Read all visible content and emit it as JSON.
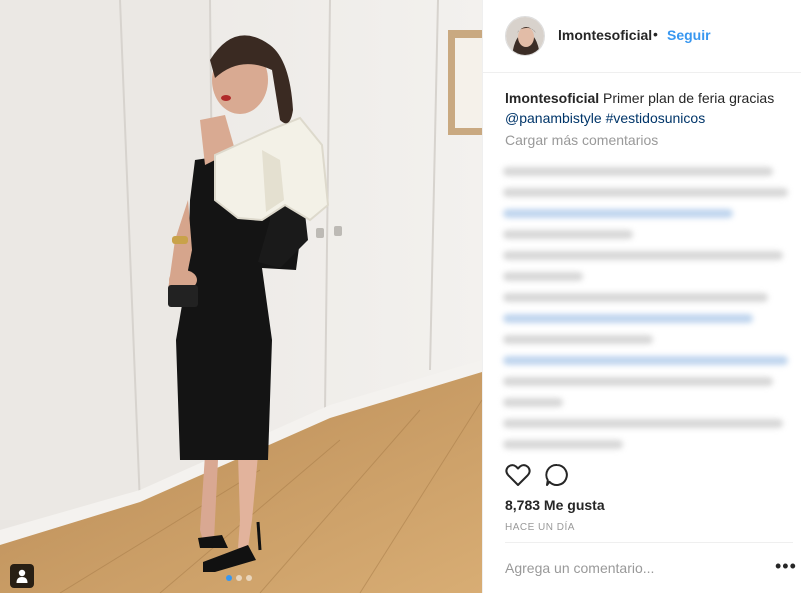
{
  "post": {
    "username": "lmontesoficial",
    "separator": "•",
    "follow_label": "Seguir",
    "caption_username": "lmontesoficial",
    "caption_text": "Primer plan de feria gracias",
    "caption_mention": "@panambistyle",
    "caption_hashtag": "#vestidosunicos",
    "load_more_label": "Cargar más comentarios",
    "likes_label": "8,783 Me gusta",
    "time_label": "HACE UN DÍA",
    "comment_placeholder": "Agrega un comentario...",
    "more_label": "•••"
  },
  "carousel": {
    "count": 3,
    "active": 1
  },
  "icons": {
    "like": "heart-icon",
    "comment": "comment-bubble-icon",
    "tag": "user-tag-icon",
    "more": "more-options-icon"
  },
  "colors": {
    "accent": "#3897f0",
    "text": "#262626",
    "muted": "#999999",
    "border": "#efefef",
    "hashtag": "#003569"
  }
}
